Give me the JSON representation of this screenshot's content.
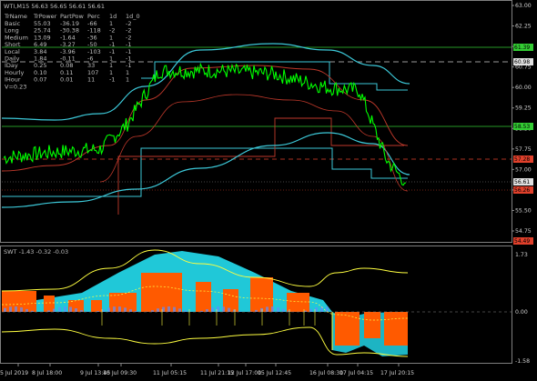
{
  "chart_title": "WTI,M15 56.63 56.65 56.61 56.61",
  "indicator_title": "SWT -1.43 -0.32 -0.03",
  "table": {
    "headers": [
      "TrName",
      "TrPower",
      "PartPow",
      "Perc",
      "1d",
      "1d_0"
    ],
    "rows": [
      [
        "Basic",
        "55.03",
        "-36.19",
        "-66",
        "1",
        "-2"
      ],
      [
        "Long",
        "25.74",
        "-30.38",
        "-118",
        "-2",
        "-2"
      ],
      [
        "Medium",
        "13.09",
        "-1.64",
        "-36",
        "1",
        "-2"
      ],
      [
        "Short",
        "6.49",
        "-3.27",
        "-50",
        "-1",
        "-1"
      ],
      [
        "Local",
        "3.84",
        "-3.96",
        "-103",
        "-1",
        "-1"
      ],
      [
        "Daily",
        "1.84",
        "-0.11",
        "-6",
        "1",
        "-1"
      ],
      [
        "IDay",
        "0.25",
        "0.08",
        "33",
        "1",
        "-1"
      ],
      [
        "Hourly",
        "0.10",
        "0.11",
        "107",
        "1",
        "1"
      ],
      [
        "IHour",
        "0.07",
        "0.01",
        "11",
        "-1",
        "1"
      ]
    ],
    "footer": "V=0.23"
  },
  "price_axis": [
    "63.00",
    "62.25",
    "61.50",
    "60.75",
    "60.00",
    "59.25",
    "58.50",
    "57.75",
    "57.00",
    "56.25",
    "55.50",
    "54.75"
  ],
  "price_tags": [
    {
      "label": "61.39",
      "color": "#33cc33"
    },
    {
      "label": "60.98",
      "color": "#e0e0e0"
    },
    {
      "label": "58.53",
      "color": "#33cc33"
    },
    {
      "label": "57.28",
      "color": "#e0402b"
    },
    {
      "label": "56.61",
      "color": "#e0e0e0"
    },
    {
      "label": "56.26",
      "color": "#e0402b"
    },
    {
      "label": "54.49",
      "color": "#e0402b"
    }
  ],
  "indicator_axis": [
    "1.73",
    "0.00",
    "-1.58"
  ],
  "time_axis": [
    "5 Jul 2019",
    "8 Jul 18:00",
    "9 Jul 13:45",
    "10 Jul 09:30",
    "11 Jul 05:15",
    "11 Jul 21:15",
    "12 Jul 17:00",
    "15 Jul 12:45",
    "16 Jul 08:30",
    "17 Jul 04:15",
    "17 Jul 20:15"
  ],
  "colors": {
    "price": "#00ff00",
    "ma_cyan": "#3cc8d8",
    "ma_red": "#c0392b",
    "histo_cyan": "#20c8d8",
    "histo_orange": "#ff5a00",
    "yellow": "#ffff40"
  },
  "chart_data": [
    {
      "type": "line",
      "title": "WTI,M15 56.63 56.65 56.61 56.61",
      "ylim": [
        54.49,
        63.0
      ],
      "x": [
        "5 Jul 2019",
        "8 Jul 18:00",
        "9 Jul 13:45",
        "10 Jul 09:30",
        "11 Jul 05:15",
        "11 Jul 21:15",
        "12 Jul 17:00",
        "15 Jul 12:45",
        "16 Jul 08:30",
        "17 Jul 04:15",
        "17 Jul 20:15"
      ],
      "series": [
        {
          "values": [
            57.5,
            57.7,
            57.8,
            58.7,
            60.6,
            60.6,
            60.5,
            60.0,
            59.9,
            57.4,
            56.6
          ]
        }
      ]
    },
    {
      "type": "area",
      "title": "SWT -1.43 -0.32 -0.03",
      "ylim": [
        -1.58,
        1.73
      ],
      "x": [
        "5 Jul 2019",
        "8 Jul 18:00",
        "9 Jul 13:45",
        "10 Jul 09:30",
        "11 Jul 05:15",
        "11 Jul 21:15",
        "12 Jul 17:00",
        "15 Jul 12:45",
        "16 Jul 08:30",
        "17 Jul 04:15",
        "17 Jul 20:15"
      ],
      "series": [
        {
          "values": [
            0.2,
            0.3,
            0.3,
            0.7,
            1.4,
            1.2,
            0.8,
            0.5,
            0.4,
            -1.0,
            -1.4
          ]
        }
      ]
    }
  ]
}
